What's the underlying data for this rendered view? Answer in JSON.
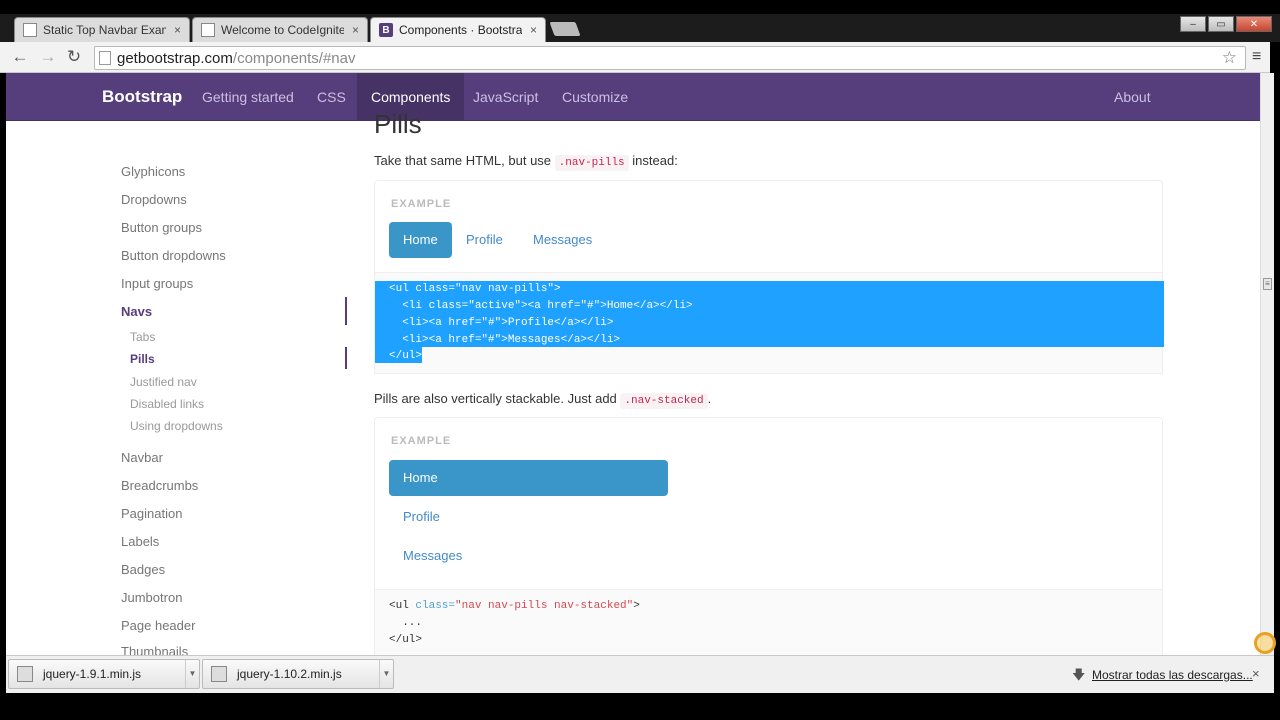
{
  "browser": {
    "tabs": [
      {
        "title": "Static Top Navbar Example",
        "close": "×",
        "favicon": "page-icon"
      },
      {
        "title": "Welcome to CodeIgniter",
        "close": "×",
        "favicon": "page-icon"
      },
      {
        "title": "Components · Bootstrap",
        "close": "×",
        "favicon": "bootstrap-icon",
        "favicon_letter": "B"
      }
    ],
    "url_host": "getbootstrap.com",
    "url_path": "/components/#nav",
    "window_controls": {
      "minimize": "–",
      "maximize": "▭",
      "close": "✕"
    },
    "back": "←",
    "forward": "→",
    "reload": "↻",
    "star": "☆",
    "menu": "≡"
  },
  "navbar": {
    "brand": "Bootstrap",
    "links": [
      {
        "label": "Getting started",
        "active": false
      },
      {
        "label": "CSS",
        "active": false
      },
      {
        "label": "Components",
        "active": true
      },
      {
        "label": "JavaScript",
        "active": false
      },
      {
        "label": "Customize",
        "active": false
      }
    ],
    "about": "About",
    "colors": {
      "bg": "#563d7c",
      "active": "#463265"
    }
  },
  "sidebar": {
    "items": [
      {
        "label": "Glyphicons"
      },
      {
        "label": "Dropdowns"
      },
      {
        "label": "Button groups"
      },
      {
        "label": "Button dropdowns"
      },
      {
        "label": "Input groups"
      },
      {
        "label": "Navs"
      }
    ],
    "subitems": [
      {
        "label": "Tabs"
      },
      {
        "label": "Pills"
      },
      {
        "label": "Justified nav"
      },
      {
        "label": "Disabled links"
      },
      {
        "label": "Using dropdowns"
      }
    ],
    "more": [
      {
        "label": "Navbar"
      },
      {
        "label": "Breadcrumbs"
      },
      {
        "label": "Pagination"
      },
      {
        "label": "Labels"
      },
      {
        "label": "Badges"
      },
      {
        "label": "Jumbotron"
      },
      {
        "label": "Page header"
      },
      {
        "label": "Thumbnails"
      }
    ]
  },
  "main": {
    "heading": "Pills",
    "intro_before": "Take that same HTML, but use ",
    "intro_code": ".nav-pills",
    "intro_after": " instead:",
    "example_label": "EXAMPLE",
    "pills": [
      "Home",
      "Profile",
      "Messages"
    ],
    "code1": [
      "<ul class=\"nav nav-pills\">",
      "  <li class=\"active\"><a href=\"#\">Home</a></li>",
      "  <li><a href=\"#\">Profile</a></li>",
      "  <li><a href=\"#\">Messages</a></li>",
      "</ul>"
    ],
    "stack_before": "Pills are also vertically stackable. Just add ",
    "stack_code": ".nav-stacked",
    "stack_after": ".",
    "stacked_pills": [
      "Home",
      "Profile",
      "Messages"
    ],
    "code2_tag": "<ul ",
    "code2_attr": "class=",
    "code2_str": "\"nav nav-pills nav-stacked\"",
    "code2_end": ">",
    "code2_dots": "  ...",
    "code2_close": "</ul>",
    "accent": "#3a95c9",
    "selection": "#1ea1ff"
  },
  "downloads": {
    "items": [
      {
        "name": "jquery-1.9.1.min.js"
      },
      {
        "name": "jquery-1.10.2.min.js"
      }
    ],
    "show_all": "Mostrar todas las descargas...",
    "close": "×",
    "arrow": "▼",
    "down_icon": "🡇"
  }
}
